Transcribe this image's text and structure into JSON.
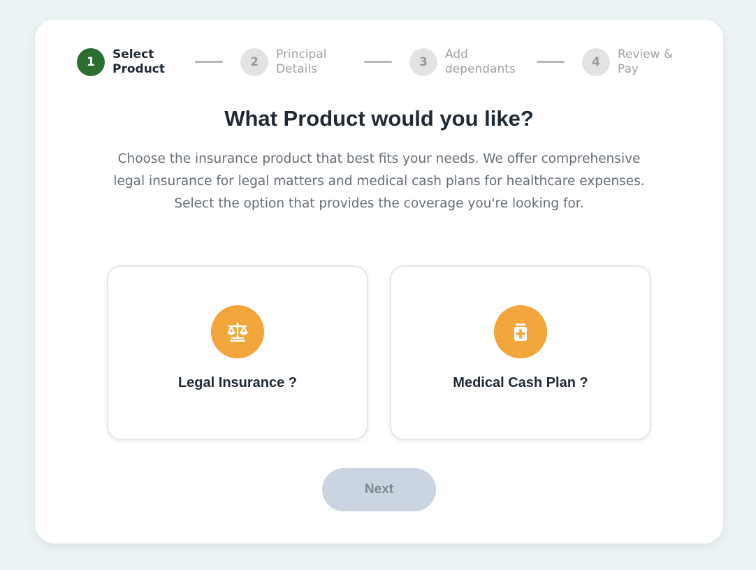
{
  "stepper": {
    "steps": [
      {
        "number": "1",
        "label": "Select\nProduct",
        "active": true
      },
      {
        "number": "2",
        "label": "Principal\nDetails",
        "active": false
      },
      {
        "number": "3",
        "label": "Add\ndependants",
        "active": false
      },
      {
        "number": "4",
        "label": "Review &\nPay",
        "active": false
      }
    ]
  },
  "main": {
    "title": "What Product would you like?",
    "description": "Choose the insurance product that best fits your needs. We offer comprehensive legal insurance for legal matters and medical cash plans for healthcare expenses. Select the option that provides the coverage you're looking for."
  },
  "options": [
    {
      "label": "Legal Insurance ?",
      "icon": "scales-icon"
    },
    {
      "label": "Medical Cash Plan ?",
      "icon": "medical-plus-icon"
    }
  ],
  "actions": {
    "next_label": "Next",
    "next_enabled": false
  },
  "colors": {
    "background": "#ecf3f5",
    "active_step": "#2c6e31",
    "inactive_step": "#e3e3e3",
    "icon_accent": "#f2a53a",
    "disabled_button": "#cbd5e1"
  }
}
